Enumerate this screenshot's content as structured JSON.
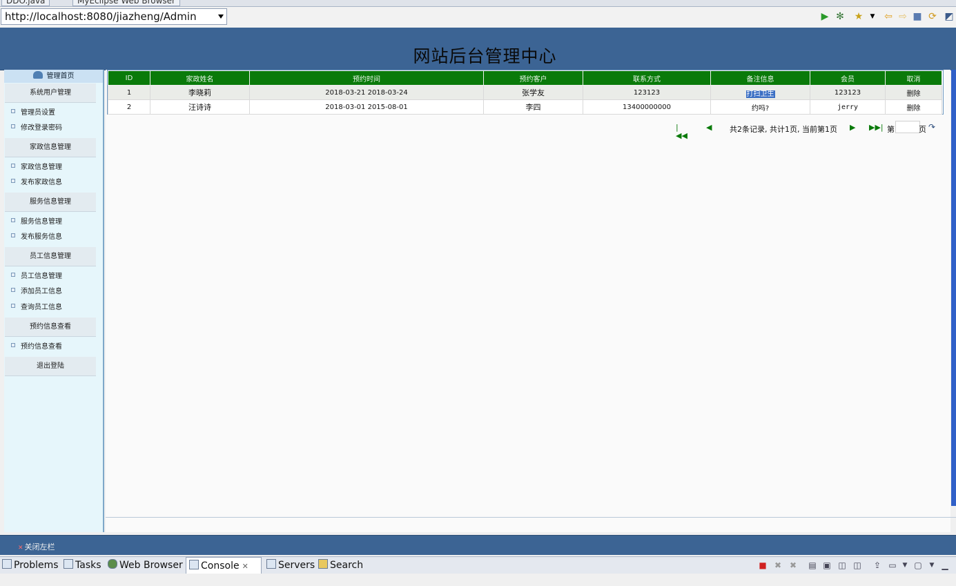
{
  "editor_tabs": [
    {
      "label": "DDO.java"
    },
    {
      "label": "MyEclipse Web Browser"
    }
  ],
  "browser": {
    "url": "http://localhost:8080/jiazheng/Admin",
    "toolbar_icons": [
      "run-icon",
      "debug-icon",
      "favorites-icon",
      "dropdown-icon",
      "back-icon",
      "forward-icon",
      "stop-icon",
      "refresh-icon",
      "perspective-icon"
    ]
  },
  "header": {
    "title": "网站后台管理中心"
  },
  "sidebar": {
    "home_label": "管理首页",
    "sections": [
      {
        "title": "系统用户管理",
        "items": [
          "管理员设置",
          "修改登录密码"
        ]
      },
      {
        "title": "家政信息管理",
        "items": [
          "家政信息管理",
          "发布家政信息"
        ]
      },
      {
        "title": "服务信息管理",
        "items": [
          "服务信息管理",
          "发布服务信息"
        ]
      },
      {
        "title": "员工信息管理",
        "items": [
          "员工信息管理",
          "添加员工信息",
          "查询员工信息"
        ]
      },
      {
        "title": "预约信息查看",
        "items": [
          "预约信息查看"
        ]
      },
      {
        "title": "退出登陆",
        "items": []
      }
    ]
  },
  "table": {
    "headers": [
      "ID",
      "家政姓名",
      "预约时间",
      "预约客户",
      "联系方式",
      "备注信息",
      "会员",
      "取消"
    ],
    "rows": [
      {
        "id": "1",
        "name": "李晓莉",
        "time": "2018-03-21 2018-03-24",
        "customer": "张学友",
        "contact": "123123",
        "note": "打扫卫生",
        "member": "123123",
        "action": "删除"
      },
      {
        "id": "2",
        "name": "汪诗诗",
        "time": "2018-03-01 2015-08-01",
        "customer": "李四",
        "contact": "13400000000",
        "note": "约吗?",
        "member": "jerry",
        "action": "删除"
      }
    ]
  },
  "pager": {
    "summary": "共2条记录, 共计1页, 当前第1页",
    "goto_prefix": "第",
    "goto_suffix": "页",
    "page_input_value": ""
  },
  "footer": {
    "close_sidebar_label": "关闭左栏"
  },
  "bottom_tabs": [
    {
      "label": "Problems",
      "active": false
    },
    {
      "label": "Tasks",
      "active": false
    },
    {
      "label": "Web Browser",
      "active": false
    },
    {
      "label": "Console",
      "active": true
    },
    {
      "label": "Servers",
      "active": false
    },
    {
      "label": "Search",
      "active": false
    }
  ],
  "colors": {
    "header_blue": "#3c6494",
    "table_header_green": "#0a7a0a",
    "sidebar_bg": "#e6f6fb"
  }
}
